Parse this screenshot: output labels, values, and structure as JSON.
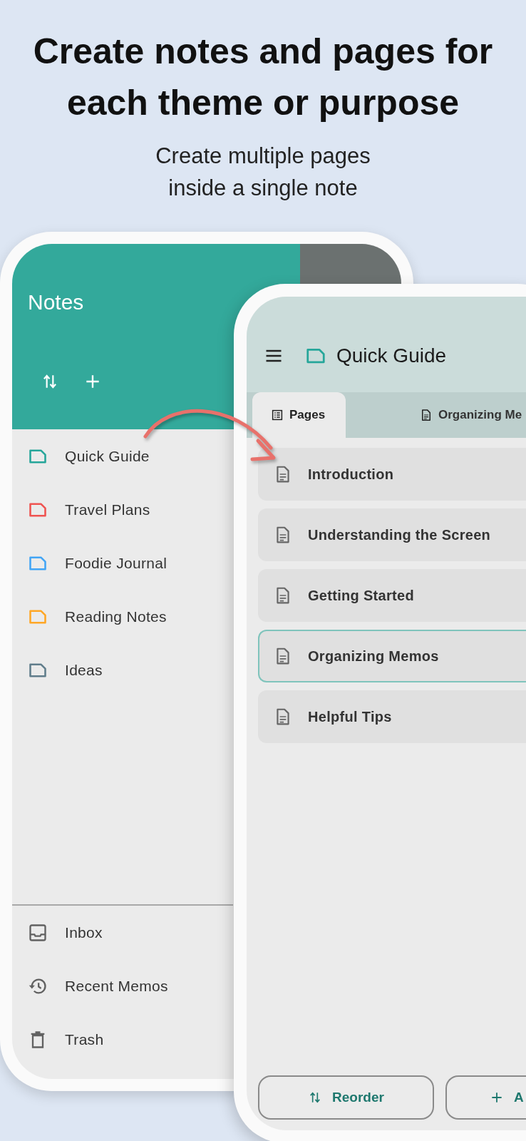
{
  "headline": {
    "title": "Create notes and pages for each theme or purpose",
    "subtitle": "Create multiple pages inside a single note"
  },
  "drawer": {
    "title": "Notes",
    "notebooks": [
      {
        "label": "Quick Guide",
        "color": "#26a69a"
      },
      {
        "label": "Travel Plans",
        "color": "#ef5350"
      },
      {
        "label": "Foodie Journal",
        "color": "#42a5f5"
      },
      {
        "label": "Reading Notes",
        "color": "#ffa726"
      },
      {
        "label": "Ideas",
        "color": "#607d8b"
      }
    ],
    "bottom_items": [
      {
        "label": "Inbox",
        "kind": "inbox"
      },
      {
        "label": "Recent Memos",
        "kind": "history"
      },
      {
        "label": "Trash",
        "kind": "trash"
      }
    ]
  },
  "note": {
    "title": "Quick Guide",
    "color": "#26a69a",
    "tabs": [
      {
        "label": "Pages",
        "kind": "list",
        "selected": true
      },
      {
        "label": "Organizing Me",
        "kind": "page",
        "selected": false
      }
    ],
    "pages": [
      {
        "label": "Introduction",
        "selected": false
      },
      {
        "label": "Understanding the Screen",
        "selected": false
      },
      {
        "label": "Getting Started",
        "selected": false
      },
      {
        "label": "Organizing Memos",
        "selected": true
      },
      {
        "label": "Helpful Tips",
        "selected": false
      }
    ],
    "buttons": [
      {
        "label": "Reorder",
        "kind": "reorder"
      },
      {
        "label": "A",
        "kind": "add"
      }
    ]
  }
}
